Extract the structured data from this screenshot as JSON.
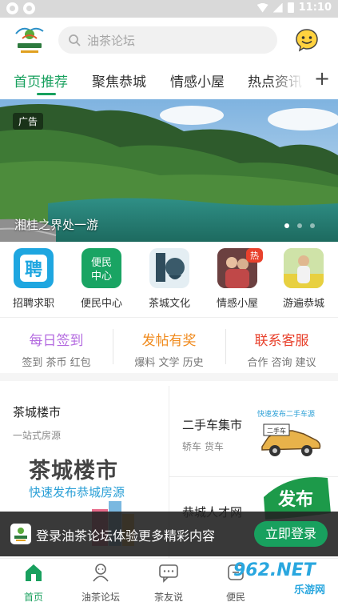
{
  "status_bar": {
    "time": "11:10"
  },
  "search": {
    "placeholder": "油茶论坛"
  },
  "tabs": [
    {
      "label": "首页推荐",
      "active": true
    },
    {
      "label": "聚焦恭城",
      "active": false
    },
    {
      "label": "情感小屋",
      "active": false
    },
    {
      "label": "热点资讯",
      "active": false
    }
  ],
  "banner": {
    "tag": "广告",
    "caption": "湘桂之界处一游",
    "page_count": 3,
    "current_page": 1
  },
  "grid": [
    {
      "label": "招聘求职",
      "icon": "recruit-icon",
      "color": "#1ea6e0"
    },
    {
      "label": "便民中心",
      "icon": "service-center-icon",
      "color": "#19a463"
    },
    {
      "label": "茶城文化",
      "icon": "tea-culture-icon",
      "color": "#e4eef3"
    },
    {
      "label": "情感小屋",
      "icon": "emotion-photo-icon",
      "color": "#b06060",
      "badge": "热"
    },
    {
      "label": "游遍恭城",
      "icon": "travel-photo-icon",
      "color": "#9ac06a"
    }
  ],
  "quick_links": [
    {
      "title": "每日签到",
      "sub": "签到 茶币 红包",
      "color": "#b46be0"
    },
    {
      "title": "发帖有奖",
      "sub": "爆料 文学 历史",
      "color": "#f08a1c"
    },
    {
      "title": "联系客服",
      "sub": "合作 咨询 建议",
      "color": "#e8412c"
    }
  ],
  "cards": {
    "left": {
      "title": "茶城楼市",
      "sub": "一站式房源",
      "big": "茶城楼市",
      "blue": "快速发布恭城房源"
    },
    "right_top": {
      "title": "二手车集市",
      "sub": "轿车 货车",
      "promo": "快速发布二手车源",
      "car_tag": "二手车"
    },
    "right_bottom": {
      "title": "恭城人才网",
      "badge": "发布"
    }
  },
  "login_bar": {
    "text": "登录油茶论坛体验更多精彩内容",
    "button": "立即登录"
  },
  "bottom_nav": [
    {
      "label": "首页",
      "icon": "home-icon",
      "active": true
    },
    {
      "label": "油茶论坛",
      "icon": "forum-icon",
      "active": false
    },
    {
      "label": "茶友说",
      "icon": "chat-icon",
      "active": false
    },
    {
      "label": "便民",
      "icon": "service-icon",
      "active": false
    }
  ],
  "watermark": {
    "brand": "962.NET",
    "sub": "乐游网"
  },
  "colors": {
    "brand_green": "#18a05e",
    "accent_blue": "#2aa7df"
  }
}
